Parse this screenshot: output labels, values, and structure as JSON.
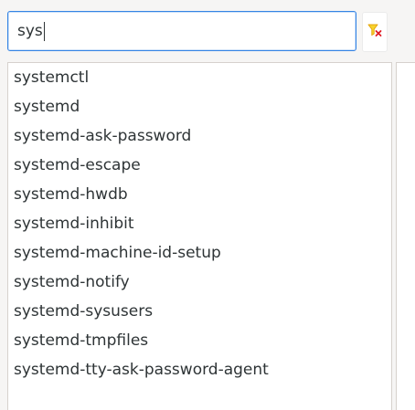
{
  "search": {
    "value": "sys"
  },
  "toolbar": {
    "clear_filter_icon": "filter-clear-icon",
    "icon_colors": {
      "funnel": "#e5a50a",
      "cross": "#e01b24"
    }
  },
  "results": {
    "items": [
      "systemctl",
      "systemd",
      "systemd-ask-password",
      "systemd-escape",
      "systemd-hwdb",
      "systemd-inhibit",
      "systemd-machine-id-setup",
      "systemd-notify",
      "systemd-sysusers",
      "systemd-tmpfiles",
      "systemd-tty-ask-password-agent"
    ]
  }
}
